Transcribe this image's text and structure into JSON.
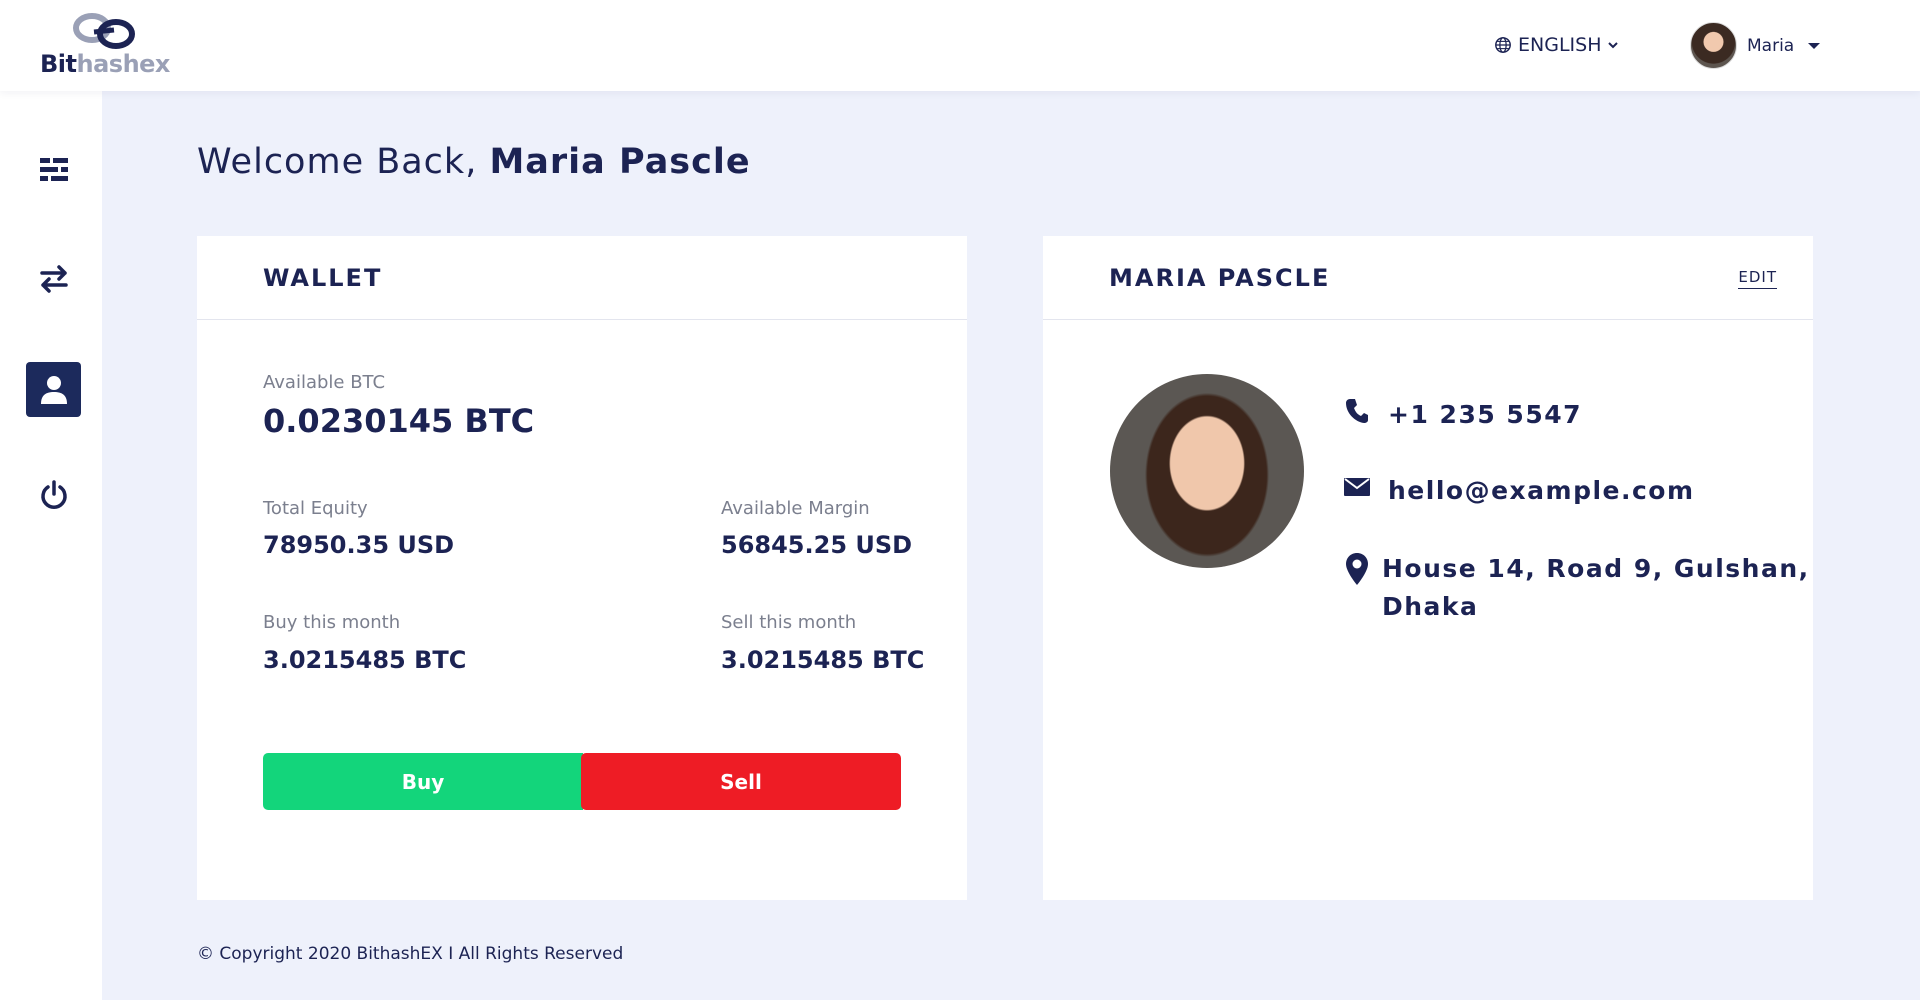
{
  "header": {
    "logo_part1": "Bit",
    "logo_part2": "hashex",
    "language": "ENGLISH",
    "user_name": "Maria"
  },
  "sidebar": {
    "items": [
      {
        "icon": "dashboard-icon",
        "active": false
      },
      {
        "icon": "exchange-arrows-icon",
        "active": false
      },
      {
        "icon": "user-icon",
        "active": true
      },
      {
        "icon": "power-icon",
        "active": false
      }
    ]
  },
  "welcome": {
    "prefix": "Welcome Back,",
    "name": "Maria Pascle"
  },
  "wallet": {
    "title": "WALLET",
    "available_btc_label": "Available BTC",
    "available_btc_value": "0.0230145 BTC",
    "total_equity_label": "Total Equity",
    "total_equity_value": "78950.35 USD",
    "available_margin_label": "Available Margin",
    "available_margin_value": "56845.25 USD",
    "buy_month_label": "Buy this month",
    "buy_month_value": "3.0215485 BTC",
    "sell_month_label": "Sell this month",
    "sell_month_value": "3.0215485 BTC",
    "buy_label": "Buy",
    "sell_label": "Sell"
  },
  "profile": {
    "title": "MARIA PASCLE",
    "edit_label": "EDIT",
    "phone": "+1 235 5547",
    "email": "hello@example.com",
    "address_line1": "House 14, Road 9, Gulshan,",
    "address_line2": "Dhaka"
  },
  "footer": {
    "copyright": "© Copyright 2020 BithashEX I All Rights Reserved"
  },
  "colors": {
    "navy": "#1c2353",
    "buy_green": "#13d57b",
    "sell_red": "#ee1c25",
    "page_bg": "#eef1fb"
  }
}
